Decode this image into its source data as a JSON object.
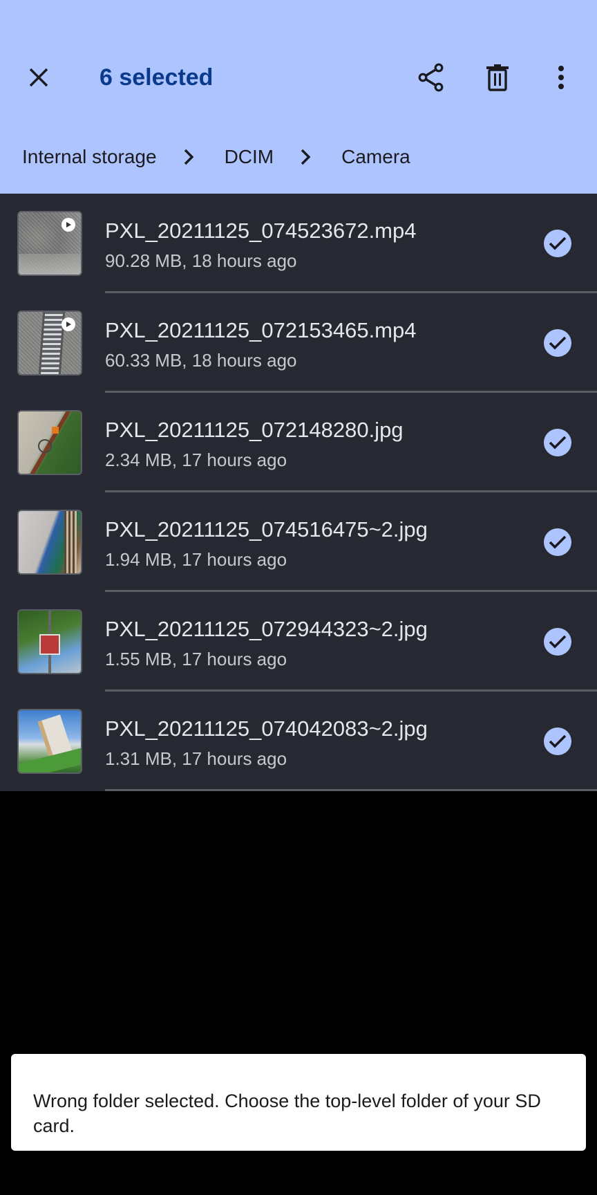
{
  "appbar": {
    "title": "6 selected",
    "close_icon": "close-icon",
    "actions": [
      {
        "name": "share",
        "icon": "share-icon"
      },
      {
        "name": "delete",
        "icon": "trash-icon"
      },
      {
        "name": "more",
        "icon": "more-vertical-icon"
      }
    ]
  },
  "breadcrumb": [
    "Internal storage",
    "DCIM",
    "Camera"
  ],
  "files": [
    {
      "name": "PXL_20211125_074523672.mp4",
      "meta": "90.28 MB, 18 hours ago",
      "type": "video",
      "selected": true
    },
    {
      "name": "PXL_20211125_072153465.mp4",
      "meta": "60.33 MB, 18 hours ago",
      "type": "video",
      "selected": true
    },
    {
      "name": "PXL_20211125_072148280.jpg",
      "meta": "2.34 MB, 17 hours ago",
      "type": "image",
      "selected": true
    },
    {
      "name": "PXL_20211125_074516475~2.jpg",
      "meta": "1.94 MB, 17 hours ago",
      "type": "image",
      "selected": true
    },
    {
      "name": "PXL_20211125_072944323~2.jpg",
      "meta": "1.55 MB, 17 hours ago",
      "type": "image",
      "selected": true
    },
    {
      "name": "PXL_20211125_074042083~2.jpg",
      "meta": "1.31 MB, 17 hours ago",
      "type": "image",
      "selected": true
    }
  ],
  "toast": {
    "message": "Wrong folder selected. Choose the top-level folder of your SD card."
  },
  "colors": {
    "appbar_bg": "#aec4ff",
    "title": "#0b3a8c",
    "list_bg": "#262932",
    "check_bg": "#aec4ff"
  }
}
